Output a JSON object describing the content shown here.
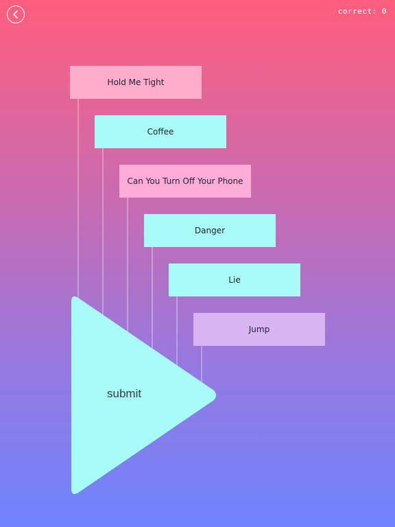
{
  "header": {
    "back_icon": "chevron-left-icon",
    "score_text": "correct: 0"
  },
  "words": [
    {
      "label": "Hold Me Tight",
      "color": "#ffadcb"
    },
    {
      "label": "Coffee",
      "color": "#a8fbf6"
    },
    {
      "label": "Can You Turn Off Your Phone",
      "color": "#ffadd6"
    },
    {
      "label": "Danger",
      "color": "#a8fbf6"
    },
    {
      "label": "Lie",
      "color": "#a8fbf6"
    },
    {
      "label": "Jump",
      "color": "#d8b4f3"
    }
  ],
  "submit": {
    "label": "submit",
    "color": "#a8fbf6"
  }
}
